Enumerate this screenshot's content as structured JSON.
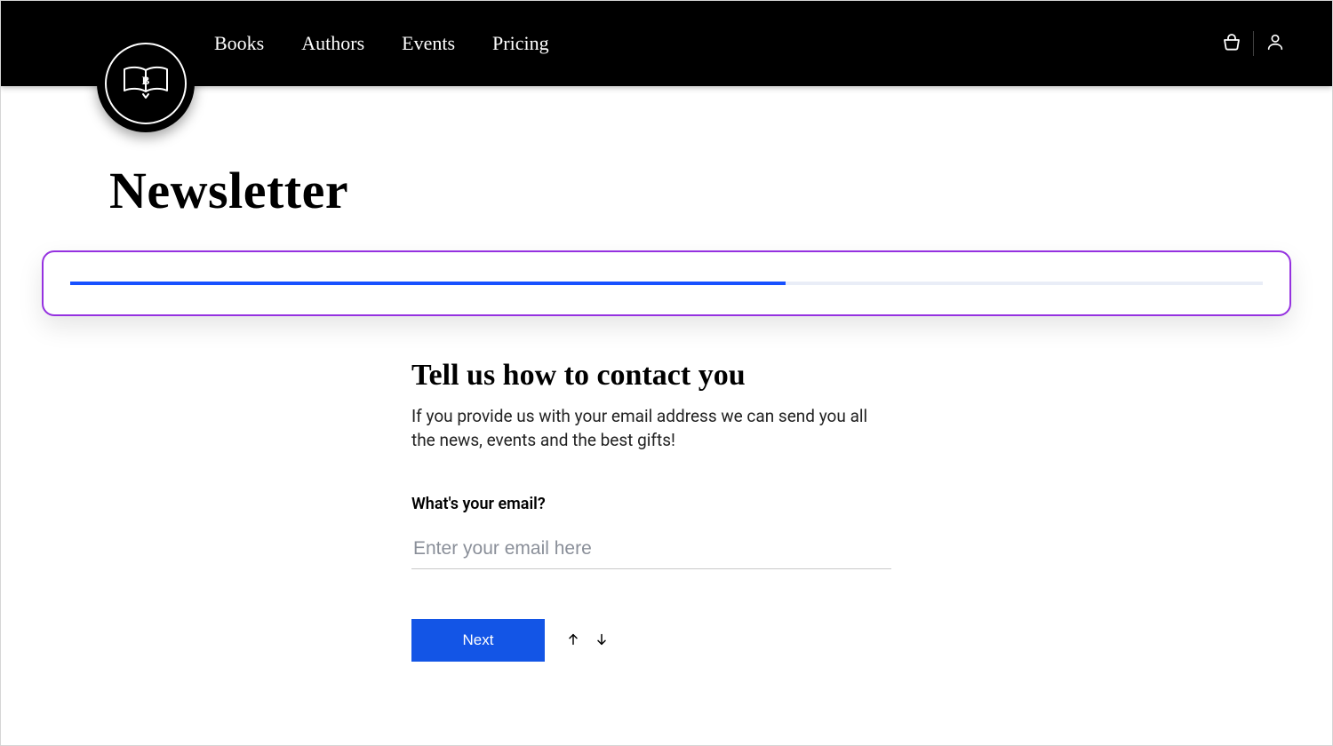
{
  "nav": {
    "items": [
      "Books",
      "Authors",
      "Events",
      "Pricing"
    ]
  },
  "page": {
    "title": "Newsletter"
  },
  "progress": {
    "percent": 60,
    "accent": "#1751ff",
    "border": "#9531e0"
  },
  "form": {
    "heading": "Tell us how to contact you",
    "subtext": "If you provide us with your email address we can send you all the news, events and the best gifts!",
    "email_label": "What's your email?",
    "email_placeholder": "Enter your email here",
    "email_value": "",
    "next_label": "Next"
  },
  "icons": {
    "logo": "book-logo-icon",
    "cart": "basket-icon",
    "user": "user-icon",
    "up": "arrow-up-icon",
    "down": "arrow-down-icon"
  }
}
